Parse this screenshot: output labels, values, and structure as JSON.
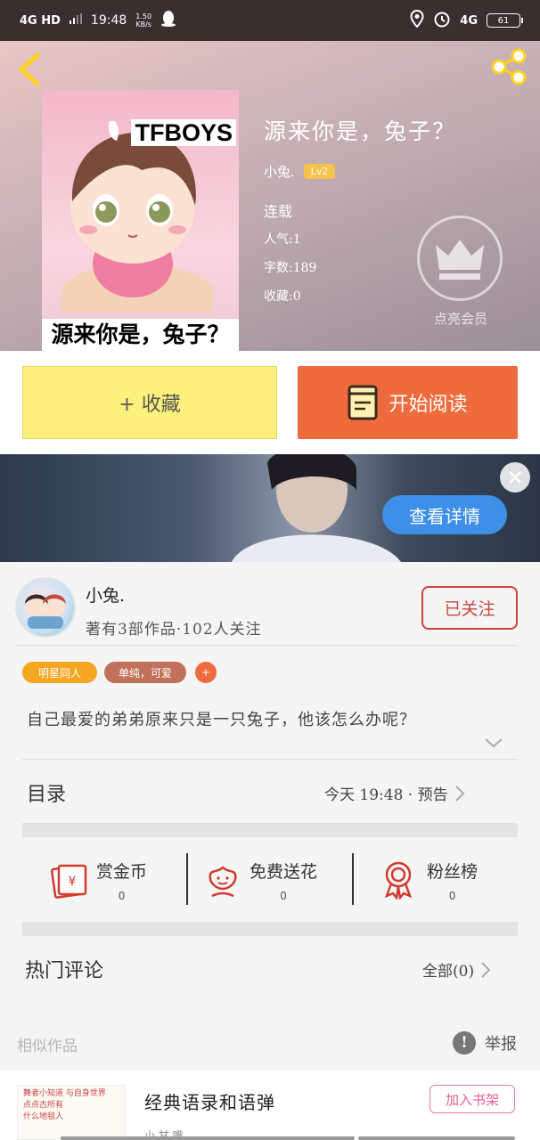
{
  "status_bar": {
    "network": "4G HD",
    "time": "19:48",
    "speed_value": "1.50",
    "speed_unit": "KB/s",
    "net_right": "4G",
    "battery": "61"
  },
  "book": {
    "title": "源来你是，兔子？",
    "cover_tag": "TFBOYS",
    "cover_caption": "源来你是，兔子？",
    "author": "小兔.",
    "level": "Lv2",
    "status": "连载",
    "popularity": "人气:1",
    "word_count": "字数:189",
    "favorites": "收藏:0",
    "vip_label": "点亮会员"
  },
  "actions": {
    "collect": "+ 收藏",
    "read": "开始阅读"
  },
  "banner": {
    "cta": "查看详情"
  },
  "author_card": {
    "name": "小兔.",
    "stats": "著有3部作品·102人关注",
    "follow": "已关注",
    "tags": [
      "明星同人",
      "单纯，可爱",
      "+"
    ],
    "description": "自己最爱的弟弟原来只是一只兔子，他该怎么办呢？"
  },
  "catalog": {
    "label": "目录",
    "update": "今天 19:48 · 预告"
  },
  "stats": {
    "reward_label": "赏金币",
    "reward_value": "0",
    "flower_label": "免费送花",
    "flower_value": "0",
    "fans_label": "粉丝榜",
    "fans_value": "0"
  },
  "comments": {
    "label": "热门评论",
    "all": "全部(0)"
  },
  "similar": {
    "label": "相似作品",
    "report": "举报",
    "item_title": "经典语录和语弹",
    "item_sub": "小 甘 嘴",
    "shelf_btn": "加入书架",
    "thumb_lines": [
      "舞者小知道 与自身世界",
      "点点古所有",
      "什么地毯人"
    ]
  },
  "colors": {
    "accent_orange": "#ee6b3d",
    "collect_yellow": "#fcf17c",
    "follow_red": "#c8463c",
    "banner_blue": "#3d8fe8",
    "back_yellow": "#ffd21f"
  }
}
